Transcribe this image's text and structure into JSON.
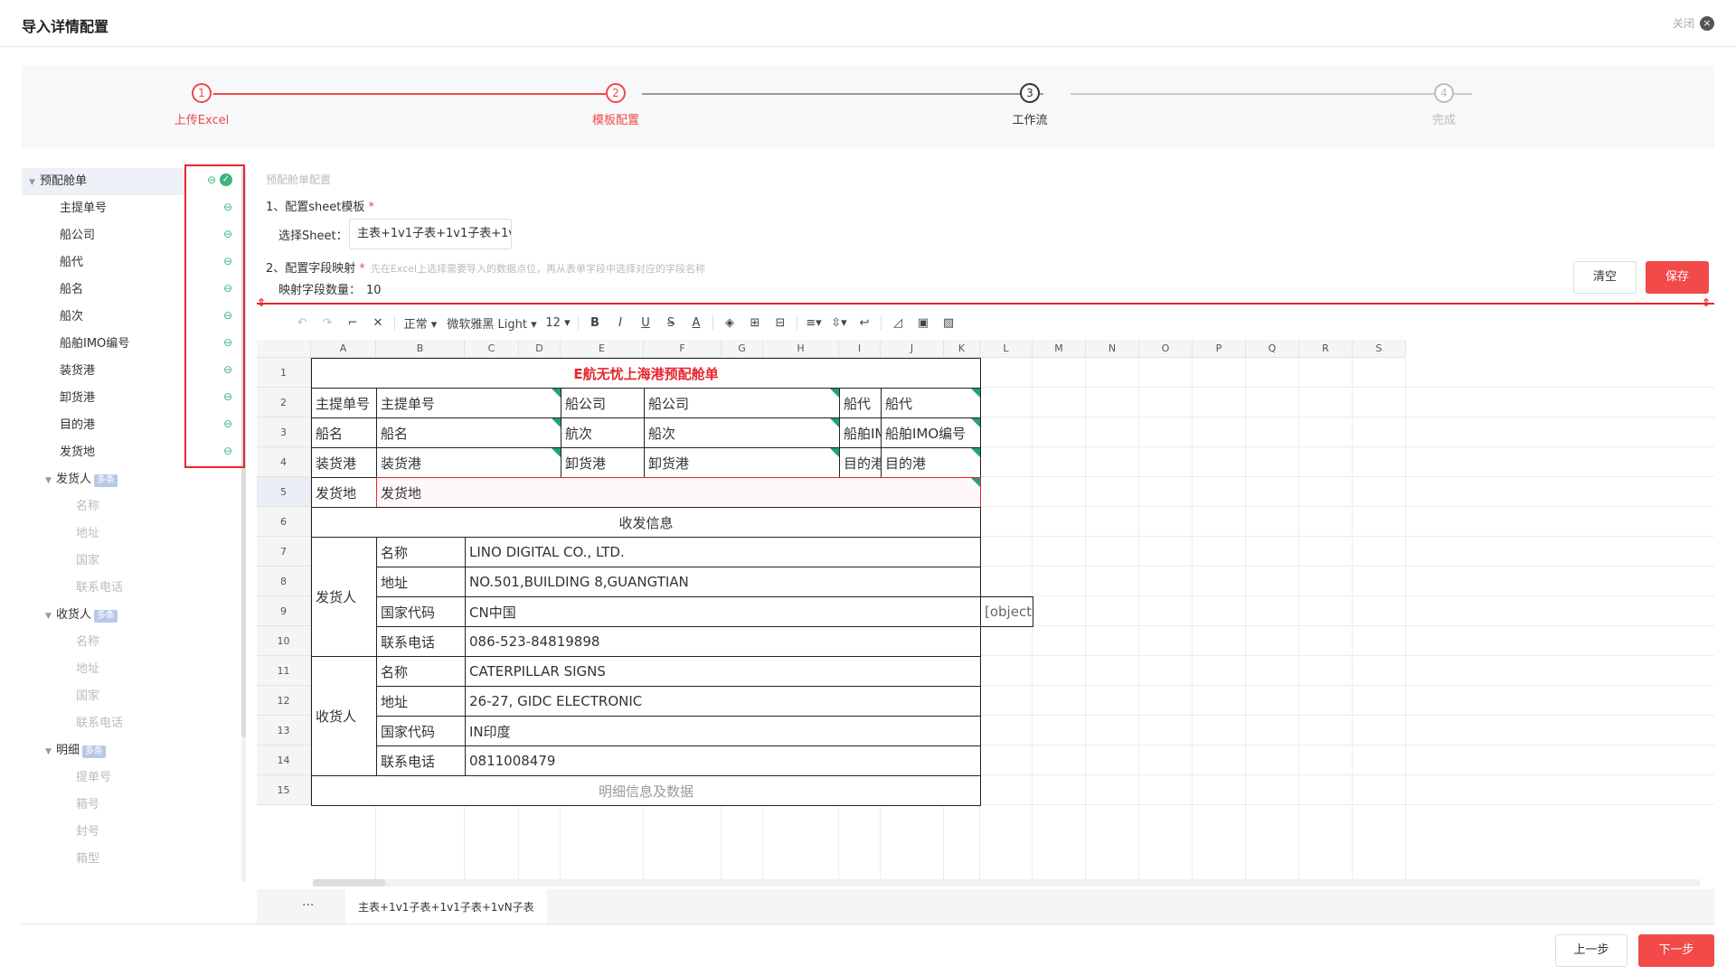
{
  "header": {
    "title": "导入详情配置",
    "close_label": "关闭"
  },
  "steps": [
    {
      "num": "1",
      "label": "上传Excel"
    },
    {
      "num": "2",
      "label": "模板配置"
    },
    {
      "num": "3",
      "label": "工作流"
    },
    {
      "num": "4",
      "label": "完成"
    }
  ],
  "tree": {
    "root": "预配舱单",
    "fields": [
      "主提单号",
      "船公司",
      "船代",
      "船名",
      "船次",
      "船舶IMO编号",
      "装货港",
      "卸货港",
      "目的港",
      "发货地"
    ],
    "groups": [
      {
        "label": "发货人",
        "tag": "多条",
        "children": [
          "名称",
          "地址",
          "国家",
          "联系电话"
        ]
      },
      {
        "label": "收货人",
        "tag": "多条",
        "children": [
          "名称",
          "地址",
          "国家",
          "联系电话"
        ]
      },
      {
        "label": "明细",
        "tag": "多条",
        "children": [
          "提单号",
          "箱号",
          "封号",
          "箱型"
        ]
      }
    ]
  },
  "config": {
    "heading": "预配舱单配置",
    "step1": "1、配置sheet模板",
    "select_label": "选择Sheet：",
    "select_value": "主表+1v1子表+1v1子表+1v",
    "step2": "2、配置字段映射",
    "step2_hint": "先在Excel上选择需要导入的数据点位，再从表单字段中选择对应的字段名称",
    "count_label": "映射字段数量：",
    "count_value": "10",
    "clear_label": "清空",
    "save_label": "保存"
  },
  "toolbar": {
    "style": "正常",
    "font": "微软雅黑 Light",
    "size": "12"
  },
  "columns": [
    "A",
    "B",
    "C",
    "D",
    "E",
    "F",
    "G",
    "H",
    "I",
    "J",
    "K",
    "L",
    "M",
    "N",
    "O",
    "P",
    "Q",
    "R",
    "S"
  ],
  "rows": [
    "1",
    "2",
    "3",
    "4",
    "5",
    "6",
    "7",
    "8",
    "9",
    "10",
    "11",
    "12",
    "13",
    "14",
    "15"
  ],
  "sheet_cells": {
    "title": "E航无忧上海港预配舱单",
    "r2": [
      "主提单号",
      "主提单号",
      "船公司",
      "船公司",
      "船代",
      "船代"
    ],
    "r3": [
      "船名",
      "船名",
      "航次",
      "船次",
      "船舶IMO编号",
      "船舶IMO编号"
    ],
    "r4": [
      "装货港",
      "装货港",
      "卸货港",
      "卸货港",
      "目的港",
      "目的港"
    ],
    "r5": [
      "发货地",
      "发货地"
    ],
    "r6": "收发信息",
    "shipper": "发货人",
    "consignee": "收货人",
    "shipper_rows": [
      [
        "名称",
        "LINO DIGITAL CO., LTD."
      ],
      [
        "地址",
        "NO.501,BUILDING 8,GUANGTIAN"
      ],
      [
        "国家代码",
        "CN中国"
      ],
      [
        "联系电话",
        "086-523-84819898"
      ]
    ],
    "consignee_rows": [
      [
        "名称",
        "CATERPILLAR SIGNS"
      ],
      [
        "地址",
        "26-27, GIDC ELECTRONIC"
      ],
      [
        "国家代码",
        "IN印度"
      ],
      [
        "联系电话",
        "0811008479"
      ]
    ],
    "r9_extra": "[object O",
    "r15": "明细信息及数据"
  },
  "sheet_tab": "主表+1v1子表+1v1子表+1vN子表",
  "sheet_more": "···",
  "footer": {
    "prev": "上一步",
    "next": "下一步"
  }
}
